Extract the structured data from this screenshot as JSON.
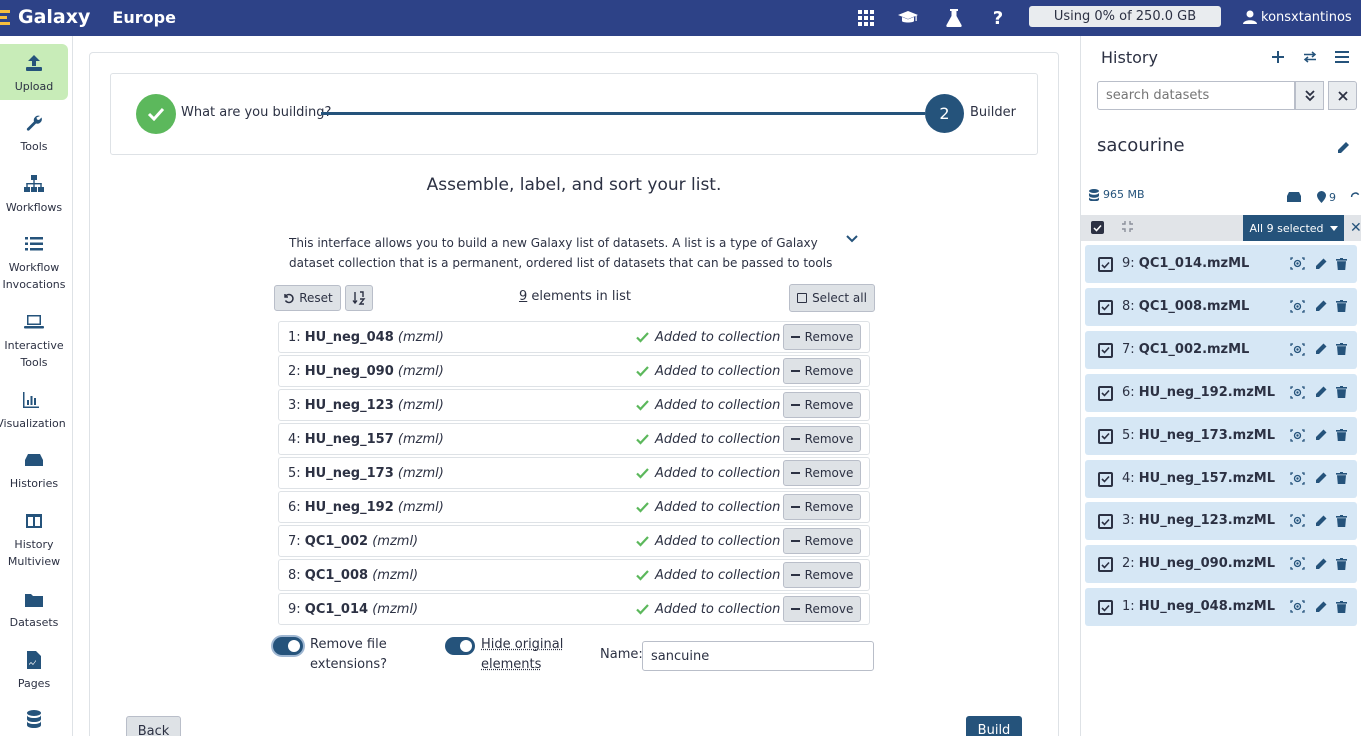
{
  "masthead": {
    "brand": "Galaxy",
    "subtitle": "Europe",
    "quota": "Using 0% of 250.0 GB",
    "username": "konsxtantinos"
  },
  "activity_bar": {
    "items": [
      {
        "label": "Upload"
      },
      {
        "label": "Tools"
      },
      {
        "label": "Workflows"
      },
      {
        "label": "Workflow Invocations"
      },
      {
        "label": "Interactive Tools"
      },
      {
        "label": "Visualization"
      },
      {
        "label": "Histories"
      },
      {
        "label": "History Multiview"
      },
      {
        "label": "Datasets"
      },
      {
        "label": "Pages"
      }
    ]
  },
  "wizard": {
    "step1_label": "What are you building?",
    "step2_number": "2",
    "step2_label": "Builder"
  },
  "builder": {
    "title": "Assemble, label, and sort your list.",
    "help": "This interface allows you to build a new Galaxy list of datasets. A list is a type of Galaxy dataset collection that is a permanent, ordered list of datasets that can be passed to tools",
    "reset_label": "Reset",
    "count": "9",
    "count_suffix": "elements in list",
    "select_all_label": "Select all",
    "elements": [
      {
        "index": "1:",
        "name": "HU_neg_048",
        "ext": "(mzml)",
        "status": "Added to collection",
        "remove": "Remove"
      },
      {
        "index": "2:",
        "name": "HU_neg_090",
        "ext": "(mzml)",
        "status": "Added to collection",
        "remove": "Remove"
      },
      {
        "index": "3:",
        "name": "HU_neg_123",
        "ext": "(mzml)",
        "status": "Added to collection",
        "remove": "Remove"
      },
      {
        "index": "4:",
        "name": "HU_neg_157",
        "ext": "(mzml)",
        "status": "Added to collection",
        "remove": "Remove"
      },
      {
        "index": "5:",
        "name": "HU_neg_173",
        "ext": "(mzml)",
        "status": "Added to collection",
        "remove": "Remove"
      },
      {
        "index": "6:",
        "name": "HU_neg_192",
        "ext": "(mzml)",
        "status": "Added to collection",
        "remove": "Remove"
      },
      {
        "index": "7:",
        "name": "QC1_002",
        "ext": "(mzml)",
        "status": "Added to collection",
        "remove": "Remove"
      },
      {
        "index": "8:",
        "name": "QC1_008",
        "ext": "(mzml)",
        "status": "Added to collection",
        "remove": "Remove"
      },
      {
        "index": "9:",
        "name": "QC1_014",
        "ext": "(mzml)",
        "status": "Added to collection",
        "remove": "Remove"
      }
    ],
    "remove_ext_label_1": "Remove file",
    "remove_ext_label_2": "extensions?",
    "hide_original_label_1": "Hide original",
    "hide_original_label_2": "elements",
    "name_label": "Name:",
    "name_value": "sancuine",
    "back_label": "Back",
    "build_label": "Build"
  },
  "history": {
    "title": "History",
    "search_placeholder": "search datasets",
    "name": "sacourine",
    "size": "965 MB",
    "dataset_count": "9",
    "select_label": "All 9 selected",
    "datasets": [
      {
        "index": "9:",
        "name": "QC1_014.mzML"
      },
      {
        "index": "8:",
        "name": "QC1_008.mzML"
      },
      {
        "index": "7:",
        "name": "QC1_002.mzML"
      },
      {
        "index": "6:",
        "name": "HU_neg_192.mzML"
      },
      {
        "index": "5:",
        "name": "HU_neg_173.mzML"
      },
      {
        "index": "4:",
        "name": "HU_neg_157.mzML"
      },
      {
        "index": "3:",
        "name": "HU_neg_123.mzML"
      },
      {
        "index": "2:",
        "name": "HU_neg_090.mzML"
      },
      {
        "index": "1:",
        "name": "HU_neg_048.mzML"
      }
    ]
  },
  "colors": {
    "masthead": "#2d4287",
    "primary": "#25537b",
    "success": "#5cb85c",
    "dataset_ok": "#d6e7f5",
    "upload_active": "#c8ecb8"
  }
}
